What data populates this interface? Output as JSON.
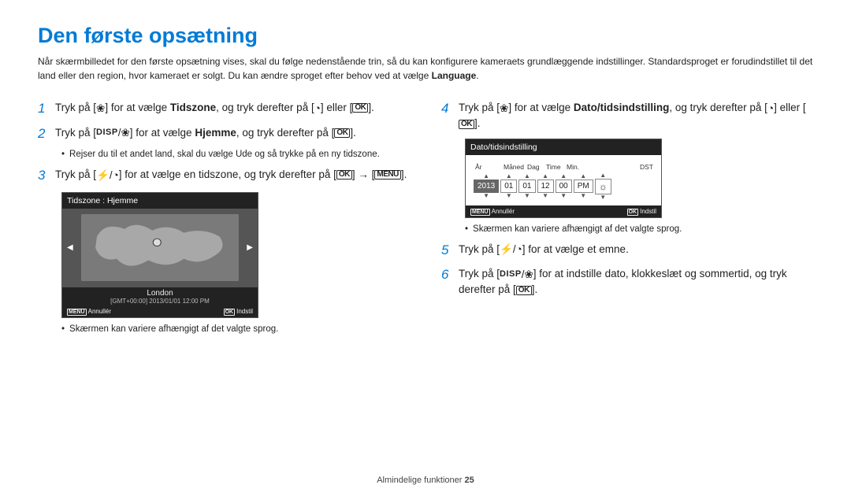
{
  "title": "Den første opsætning",
  "intro_a": "Når skærmbilledet for den første opsætning vises, skal du følge nedenstående trin, så du kan konfigurere kameraets grundlæggende indstillinger. Standardsproget er forudindstillet til det land eller den region, hvor kameraet er solgt. Du kan ændre sproget efter behov ved at vælge ",
  "intro_lang": "Language",
  "steps": {
    "s1_a": "Tryk på [",
    "s1_b": "] for at vælge ",
    "s1_bold": "Tidszone",
    "s1_c": ", og tryk derefter på [",
    "s1_d": "] eller [",
    "s1_e": "].",
    "s2_a": "Tryk på [",
    "s2_b": "] for at vælge ",
    "s2_bold": "Hjemme",
    "s2_c": ", og tryk derefter på [",
    "s2_d": "].",
    "s2_note": "Rejser du til et andet land, skal du vælge Ude og så trykke på en ny tidszone.",
    "s3_a": "Tryk på [",
    "s3_b": "] for at vælge en tidszone, og tryk derefter på [",
    "s3_c": "] → [",
    "s3_d": "].",
    "tz_header": "Tidszone : Hjemme",
    "tz_city": "London",
    "tz_sub": "[GMT+00:00] 2013/01/01 12:00 PM",
    "ftr_cancel": "Annullér",
    "ftr_set": "Indstil",
    "note_screen": "Skærmen kan variere afhængigt af det valgte sprog.",
    "s4_a": "Tryk på [",
    "s4_b": "] for at vælge ",
    "s4_bold": "Dato/tidsindstilling",
    "s4_c": ", og tryk derefter på [",
    "s4_d": "] eller [",
    "s4_e": "].",
    "dt_header": "Dato/tidsindstilling",
    "dt_labels": [
      "År",
      "Måned",
      "Dag",
      "Time",
      "Min.",
      "DST"
    ],
    "dt_vals": {
      "year": "2013",
      "month": "01",
      "day": "01",
      "hour": "12",
      "min": "00",
      "pm": "PM"
    },
    "s5_a": "Tryk på [",
    "s5_b": "] for at vælge et emne.",
    "s6_a": "Tryk på [",
    "s6_b": "] for at indstille dato, klokkeslæt og sommertid, og tryk derefter på [",
    "s6_c": "]."
  },
  "footer_a": "Almindelige funktioner  ",
  "footer_b": "25",
  "icons": {
    "flower": "❀",
    "timer": "◔",
    "slash": "/",
    "flash": "⚡",
    "arrow_r": "→",
    "dst": "☼"
  }
}
